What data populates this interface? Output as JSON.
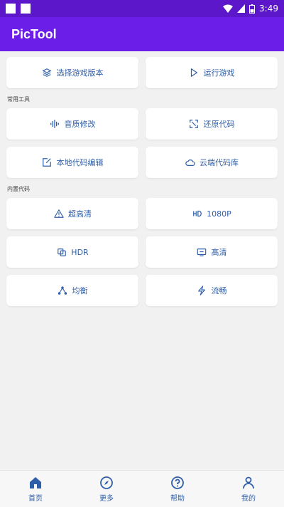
{
  "status_bar": {
    "time": "3:49"
  },
  "app": {
    "title": "PicTool"
  },
  "top_buttons": {
    "select_version": "选择游戏版本",
    "run_game": "运行游戏"
  },
  "common_tools": {
    "label": "常用工具",
    "items": [
      {
        "label": "音质修改",
        "icon": "waveform-icon"
      },
      {
        "label": "还原代码",
        "icon": "restore-icon"
      },
      {
        "label": "本地代码编辑",
        "icon": "edit-icon"
      },
      {
        "label": "云端代码库",
        "icon": "cloud-icon"
      }
    ]
  },
  "builtin_codes": {
    "label": "内置代码",
    "items": [
      {
        "label": "超高清",
        "icon": "warning-icon"
      },
      {
        "label": "1080P",
        "icon": "hd-icon"
      },
      {
        "label": "HDR",
        "icon": "hdr-icon"
      },
      {
        "label": "高清",
        "icon": "monitor-icon"
      },
      {
        "label": "均衡",
        "icon": "balance-icon"
      },
      {
        "label": "流畅",
        "icon": "bolt-icon"
      }
    ]
  },
  "bottom_nav": [
    {
      "label": "首页",
      "icon": "home-icon"
    },
    {
      "label": "更多",
      "icon": "compass-icon"
    },
    {
      "label": "帮助",
      "icon": "help-icon"
    },
    {
      "label": "我的",
      "icon": "user-icon"
    }
  ],
  "colors": {
    "statusbar": "#5b17c9",
    "appbar": "#6a1ee8",
    "accent": "#2f5fa8",
    "background": "#f1f1f1"
  }
}
